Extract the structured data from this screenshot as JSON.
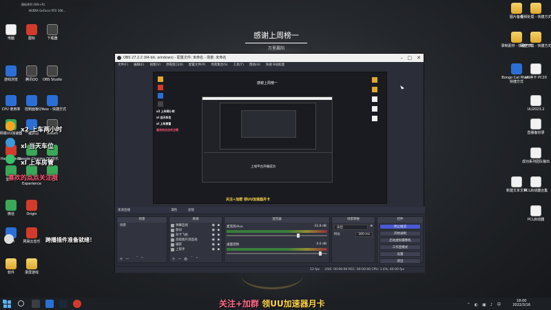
{
  "wallpaper": {
    "banner_title": "感谢上周榜一",
    "banner_sub": "万里晨阳"
  },
  "thumbnail": {
    "label": "图标阵列 (Win+R)",
    "sub": "NVIDIA GeForce RTX 306..."
  },
  "left_icons": [
    {
      "label": "电脑"
    },
    {
      "label": "图标"
    },
    {
      "label": "下载器"
    },
    {
      "label": "游戏浏览"
    },
    {
      "label": "腾讯QQ"
    },
    {
      "label": "OBS Studio"
    },
    {
      "label": "CPU 使用率"
    },
    {
      "label": "控制面板"
    },
    {
      "label": "QYesx - 快捷方式"
    },
    {
      "label": "网易UU加速器"
    },
    {
      "label": "一键启动"
    },
    {
      "label": "Steam"
    },
    {
      "label": "Halo Infinite"
    },
    {
      "label": "Google Chrome"
    },
    {
      "label": "QQ音乐"
    },
    {
      "label": "爱奇艺"
    },
    {
      "label": "GeForce Experience"
    },
    {
      "label": "YY语音"
    },
    {
      "label": "微信"
    },
    {
      "label": "Origin"
    },
    {
      "label": "KFH"
    },
    {
      "label": "网易云音乐"
    },
    {
      "label": "软件"
    },
    {
      "label": "录屏游戏"
    }
  ],
  "right_icons": [
    {
      "label": "图片备份"
    },
    {
      "label": "视频处理 - 快捷方式"
    },
    {
      "label": "录制素材 - 快捷方式"
    },
    {
      "label": "百度下载 - 快捷方式"
    },
    {
      "label": "Bongo Cat Mver - 快捷方式"
    },
    {
      "label": "UU序卡 PC20"
    },
    {
      "label": "UU2023.2"
    },
    {
      "label": "直播备份录"
    },
    {
      "label": "成功系列团队输出"
    },
    {
      "label": "新建文本文档"
    },
    {
      "label": "PCL启动器合集"
    },
    {
      "label": "PCL启动器"
    }
  ],
  "overlay": {
    "line1": "x2 上车两小时",
    "line2": "xl 当天车位",
    "line3": "xl 上车房管",
    "line4": "喜欢的点点关注哦",
    "plugin_msg": "跨播插件准备就绪！"
  },
  "obs": {
    "title": "OBS 27.2.2 (64-bit, windows) - 配置文件: 未命名 - 场景: 未命名",
    "menu": [
      "文件(F)",
      "编辑(E)",
      "视图(V)",
      "停靠窗口(D)",
      "配置文件(P)",
      "场景集合(S)",
      "工具(T)",
      "帮助(H)",
      "快速 B站助理"
    ],
    "nested_caption": "关注+加群 领UU加速器月卡",
    "nested_banner": "感谢上周榜一",
    "nested_mid_text": "上线平台开播成功",
    "scene_tabs": [
      "来源直播",
      "属性",
      "滤镜"
    ],
    "scenes": {
      "title": "场景",
      "items": [
        "场景"
      ]
    },
    "sources": {
      "title": "来源",
      "items": [
        {
          "name": "弹幕监视"
        },
        {
          "name": "歌词"
        },
        {
          "name": "杂卡飞帆"
        },
        {
          "name": "高级图片源监视"
        },
        {
          "name": "捕获"
        },
        {
          "name": "上帮手"
        }
      ]
    },
    "mixer": {
      "title": "混音器",
      "channels": [
        {
          "name": "麦克风/Aux",
          "db": "-31.8 dB"
        },
        {
          "name": "桌面音频",
          "db": "0.0 dB"
        }
      ]
    },
    "transitions": {
      "title": "场景转换",
      "type": "淡出",
      "duration_label": "时长",
      "duration": "300 ms"
    },
    "controls": {
      "title": "控件",
      "buttons": [
        "停止推流",
        "开始录制",
        "启动虚拟摄像机",
        "工作室模式",
        "设置",
        "退出"
      ]
    },
    "status": "LIVE: 00:00:00    REC: 00:00:00    CPU: 1.4%, 60.00 fps",
    "status_left": "12 fps"
  },
  "taskbar": {
    "caption_a": "关注+加群",
    "caption_b": "领UU加速器月卡",
    "time": "18:00",
    "date": "2022/3/16"
  }
}
